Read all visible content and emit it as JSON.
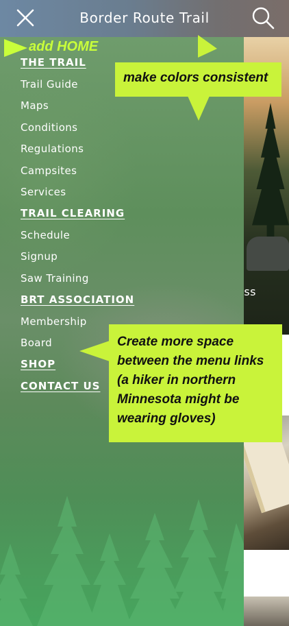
{
  "header": {
    "title": "Border Route Trail",
    "close_icon": "close-icon",
    "search_icon": "search-icon"
  },
  "menu": {
    "sections": [
      {
        "heading": "THE TRAIL",
        "links": [
          "Trail Guide",
          "Maps",
          "Conditions",
          "Regulations",
          "Campsites",
          "Services"
        ]
      },
      {
        "heading": "TRAIL CLEARING",
        "links": [
          "Schedule",
          "Signup",
          "Saw Training"
        ]
      },
      {
        "heading": "BRT ASSOCIATION",
        "links": [
          "Membership",
          "Board"
        ]
      }
    ],
    "shop": "SHOP",
    "contact": "CONTACT US"
  },
  "background": {
    "partial_word_1": "ess",
    "partial_word_2": "s"
  },
  "annotations": {
    "add_home": "add HOME",
    "colors": "make colors consistent",
    "spacing": "Create more space between the menu links (a hiker in northern Minnesota might be wearing gloves)"
  },
  "colors": {
    "annotation": "#c9f33a",
    "annotation_text": "#111111",
    "header_start": "#6d88a3",
    "drawer_bottom": "#46a65e"
  }
}
